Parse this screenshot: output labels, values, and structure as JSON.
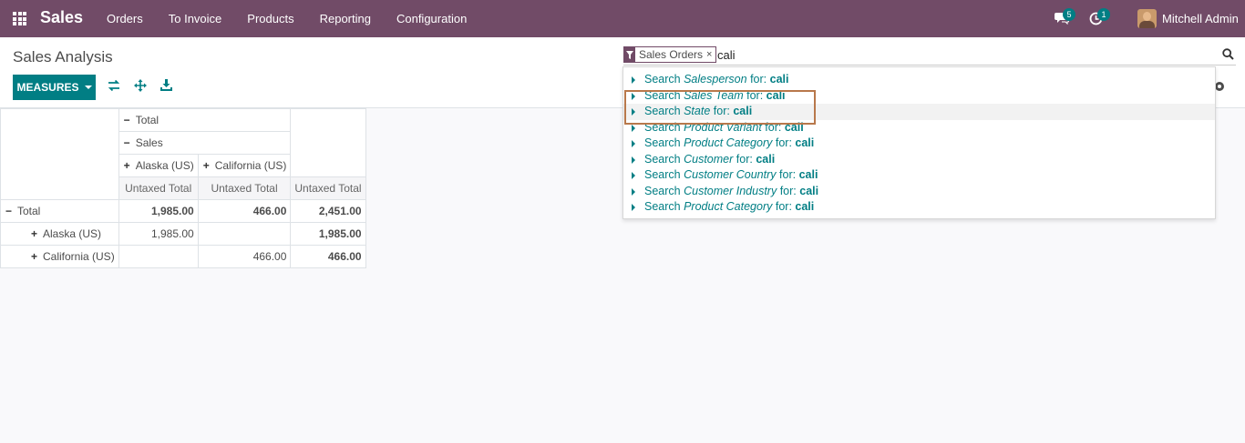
{
  "navbar": {
    "app_name": "Sales",
    "menu": [
      "Orders",
      "To Invoice",
      "Products",
      "Reporting",
      "Configuration"
    ],
    "messages_count": "5",
    "activities_count": "1",
    "user_name": "Mitchell Admin",
    "bg_color": "#714b67"
  },
  "control_panel": {
    "title": "Sales Analysis",
    "measures_label": "MEASURES"
  },
  "search": {
    "facet_label": "Sales Orders",
    "facet_remove": "×",
    "query": "cali",
    "suggestions": [
      {
        "prefix": "Search",
        "field": "Salesperson",
        "mid": "for:",
        "term": "cali"
      },
      {
        "prefix": "Search",
        "field": "Sales Team",
        "mid": "for:",
        "term": "cali"
      },
      {
        "prefix": "Search",
        "field": "State",
        "mid": "for:",
        "term": "cali"
      },
      {
        "prefix": "Search",
        "field": "Product Variant",
        "mid": "for:",
        "term": "cali"
      },
      {
        "prefix": "Search",
        "field": "Product Category",
        "mid": "for:",
        "term": "cali"
      },
      {
        "prefix": "Search",
        "field": "Customer",
        "mid": "for:",
        "term": "cali"
      },
      {
        "prefix": "Search",
        "field": "Customer Country",
        "mid": "for:",
        "term": "cali"
      },
      {
        "prefix": "Search",
        "field": "Customer Industry",
        "mid": "for:",
        "term": "cali"
      },
      {
        "prefix": "Search",
        "field": "Product Category",
        "mid": "for:",
        "term": "cali"
      }
    ]
  },
  "pivot": {
    "col_total": "Total",
    "col_group": "Sales",
    "col_alaska": "Alaska (US)",
    "col_california": "California (US)",
    "measure": "Untaxed Total",
    "rows": {
      "total": {
        "label": "Total",
        "alaska": "1,985.00",
        "california": "466.00",
        "total": "2,451.00"
      },
      "alaska": {
        "label": "Alaska (US)",
        "alaska": "1,985.00",
        "california": "",
        "total": "1,985.00"
      },
      "california": {
        "label": "California (US)",
        "alaska": "",
        "california": "466.00",
        "total": "466.00"
      }
    }
  },
  "colors": {
    "accent": "#017e84",
    "brand": "#714b67",
    "highlight_box": "#b8784b"
  }
}
